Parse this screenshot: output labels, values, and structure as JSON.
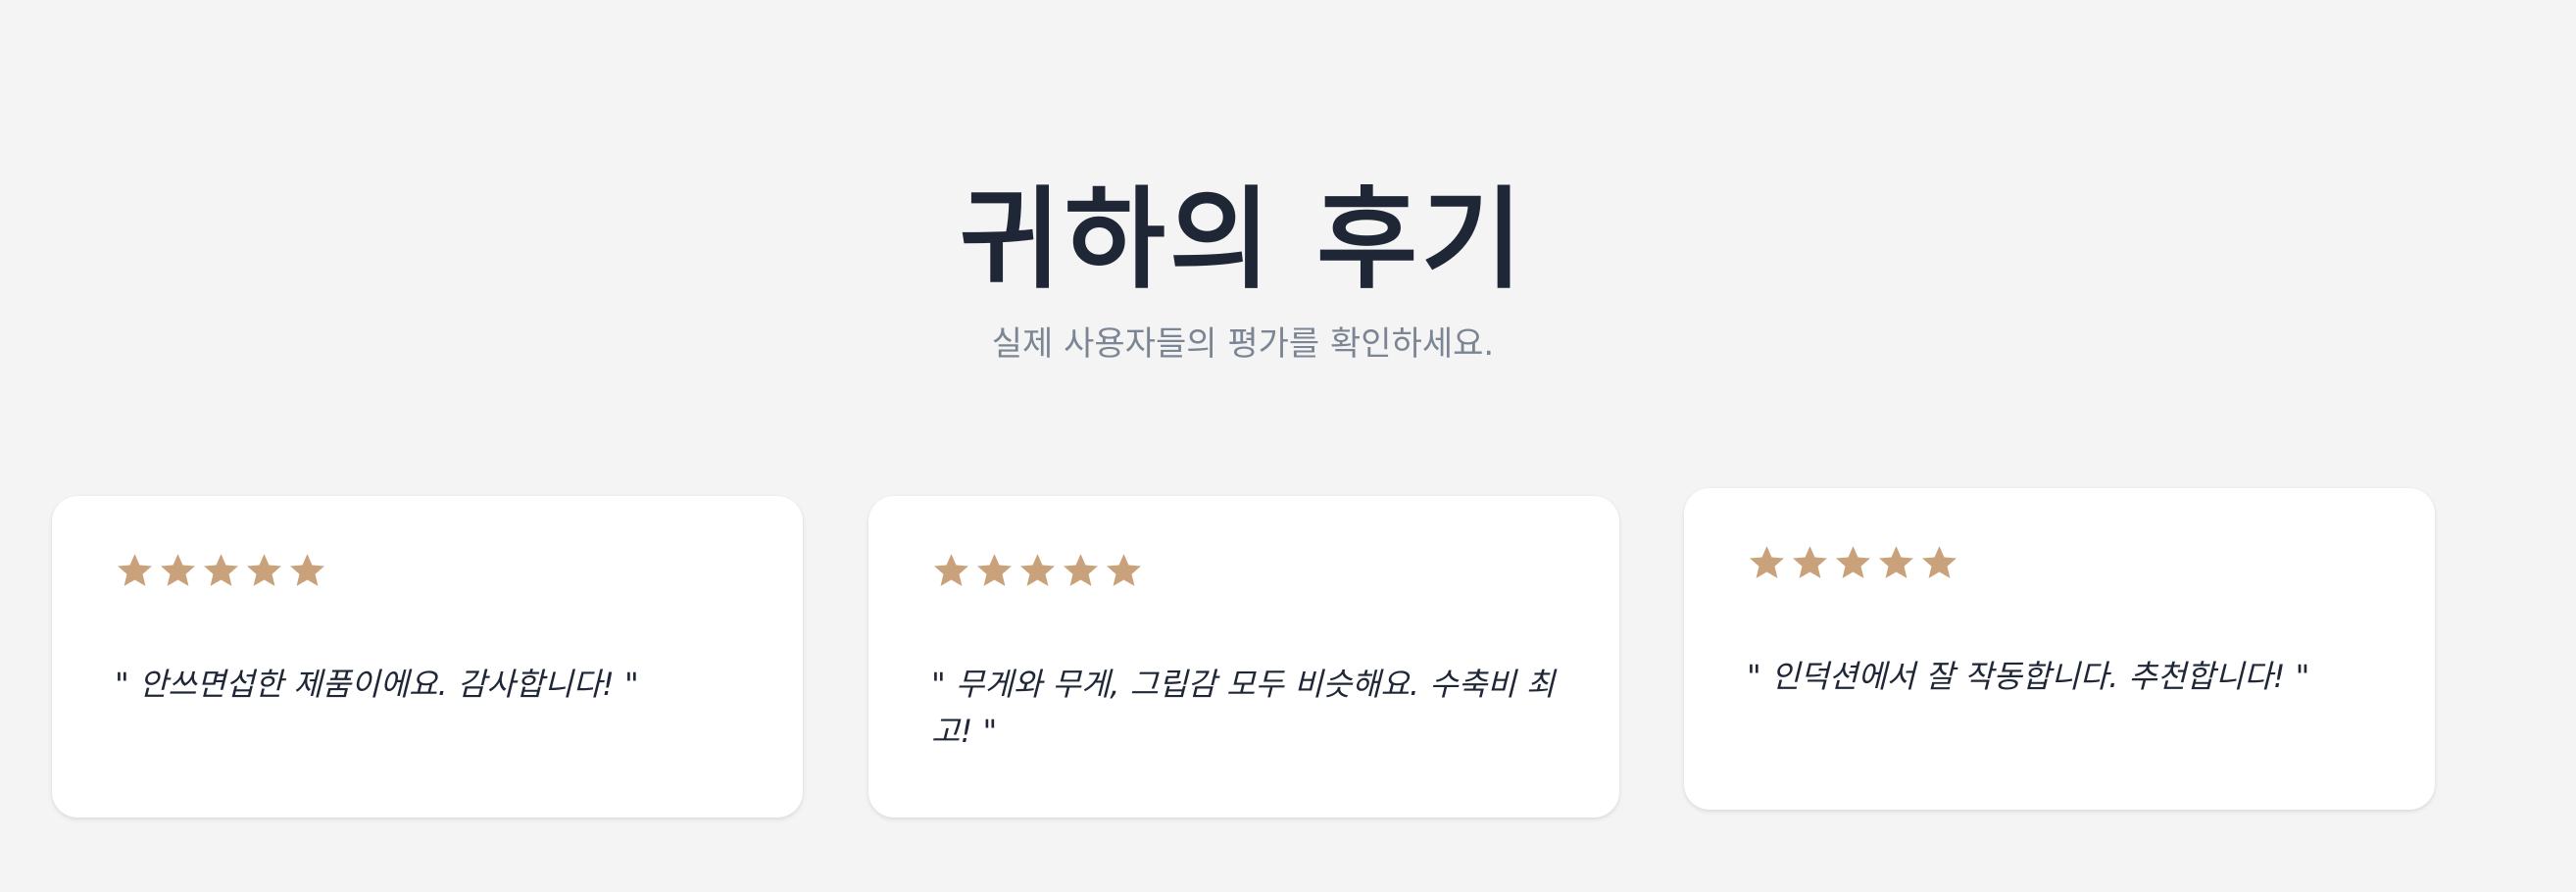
{
  "header": {
    "title": "귀하의 후기",
    "subtitle": "실제 사용자들의 평가를 확인하세요."
  },
  "colors": {
    "star": "#c9a27b",
    "text": "#1f2736",
    "muted": "#7b8593",
    "background": "#f4f4f4",
    "card": "#ffffff"
  },
  "reviews": [
    {
      "rating": 5,
      "quote": "\" 안쓰면섭한 제품이에요. 감사합니다! \""
    },
    {
      "rating": 5,
      "quote": "\" 무게와 무게, 그립감 모두 비슷해요. 수축비 최고! \""
    },
    {
      "rating": 5,
      "quote": "\" 인덕션에서 잘 작동합니다. 추천합니다! \""
    }
  ]
}
